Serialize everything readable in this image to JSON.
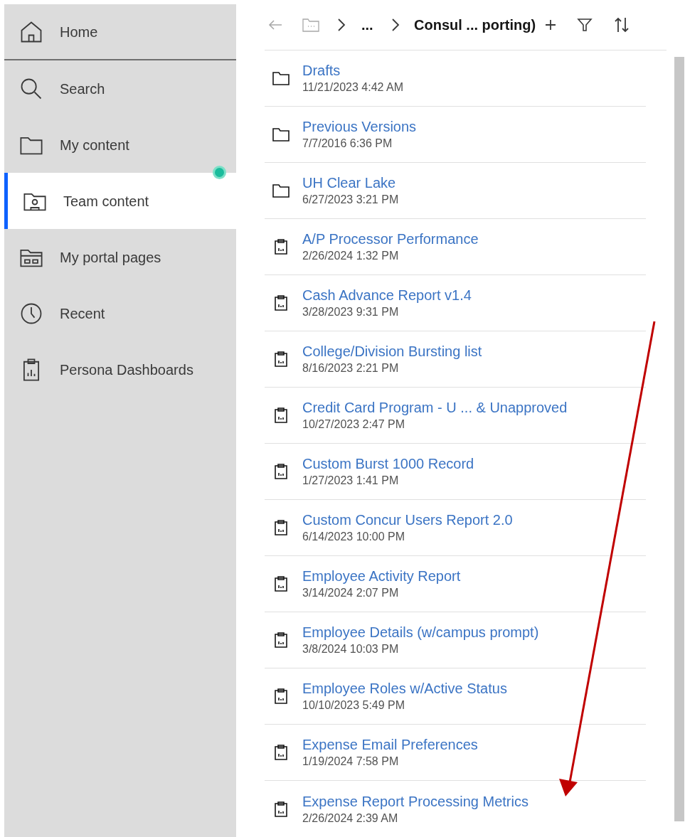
{
  "sidebar": {
    "items": [
      {
        "kind": "home",
        "label": "Home",
        "selected": false
      },
      {
        "kind": "search",
        "label": "Search",
        "selected": false
      },
      {
        "kind": "folder",
        "label": "My content",
        "selected": false
      },
      {
        "kind": "team",
        "label": "Team content",
        "selected": true,
        "notification": true
      },
      {
        "kind": "portal",
        "label": "My portal pages",
        "selected": false
      },
      {
        "kind": "recent",
        "label": "Recent",
        "selected": false
      },
      {
        "kind": "dashboard",
        "label": "Persona Dashboards",
        "selected": false
      }
    ]
  },
  "toolbar": {
    "breadcrumb": [
      "...",
      "Consul ... porting)"
    ]
  },
  "items": [
    {
      "kind": "folder",
      "name": "Drafts",
      "date": "11/21/2023 4:42 AM"
    },
    {
      "kind": "folder",
      "name": "Previous Versions",
      "date": "7/7/2016 6:36 PM"
    },
    {
      "kind": "folder",
      "name": "UH Clear Lake",
      "date": "6/27/2023 3:21 PM"
    },
    {
      "kind": "report",
      "name": "A/P Processor Performance",
      "date": "2/26/2024 1:32 PM"
    },
    {
      "kind": "report",
      "name": "Cash Advance Report v1.4",
      "date": "3/28/2023 9:31 PM"
    },
    {
      "kind": "report",
      "name": "College/Division Bursting list",
      "date": "8/16/2023 2:21 PM"
    },
    {
      "kind": "report",
      "name": "Credit Card Program - U ... & Unapproved",
      "date": "10/27/2023 2:47 PM"
    },
    {
      "kind": "report",
      "name": "Custom Burst 1000 Record",
      "date": "1/27/2023 1:41 PM"
    },
    {
      "kind": "report",
      "name": "Custom Concur Users Report 2.0",
      "date": "6/14/2023 10:00 PM"
    },
    {
      "kind": "report",
      "name": "Employee Activity Report",
      "date": "3/14/2024 2:07 PM"
    },
    {
      "kind": "report",
      "name": "Employee Details (w/campus prompt)",
      "date": "3/8/2024 10:03 PM"
    },
    {
      "kind": "report",
      "name": "Employee Roles w/Active Status",
      "date": "10/10/2023 5:49 PM"
    },
    {
      "kind": "report",
      "name": "Expense Email Preferences",
      "date": "1/19/2024 7:58 PM"
    },
    {
      "kind": "report",
      "name": "Expense Report Processing Metrics",
      "date": "2/26/2024 2:39 AM"
    }
  ]
}
